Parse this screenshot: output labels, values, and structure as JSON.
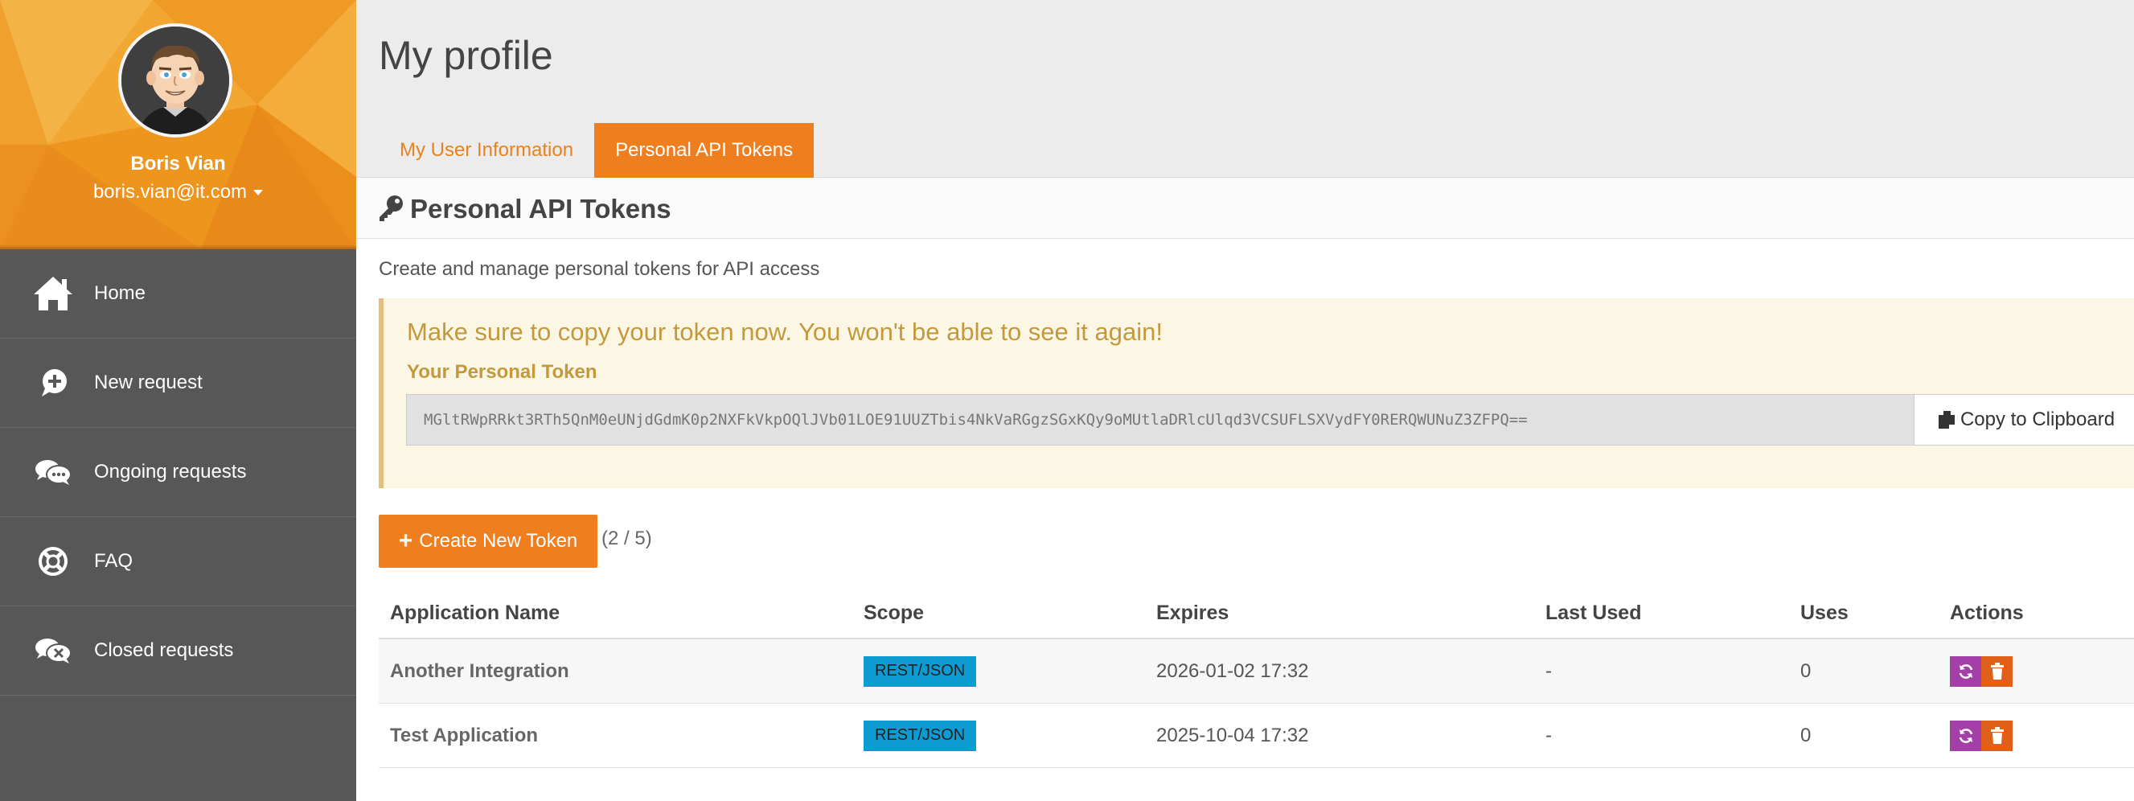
{
  "user": {
    "name": "Boris Vian",
    "email": "boris.vian@it.com"
  },
  "nav": [
    {
      "label": "Home",
      "icon": "home-icon"
    },
    {
      "label": "New request",
      "icon": "plus-bubble-icon"
    },
    {
      "label": "Ongoing requests",
      "icon": "chat-bubbles-icon"
    },
    {
      "label": "FAQ",
      "icon": "lifebuoy-icon"
    },
    {
      "label": "Closed requests",
      "icon": "closed-bubbles-icon"
    }
  ],
  "page": {
    "title": "My profile",
    "tabs": [
      {
        "label": "My User Information",
        "active": false
      },
      {
        "label": "Personal API Tokens",
        "active": true
      }
    ]
  },
  "section": {
    "title": "Personal API Tokens",
    "description": "Create and manage personal tokens for API access"
  },
  "alert": {
    "title": "Make sure to copy your token now. You won't be able to see it again!",
    "label": "Your Personal Token",
    "token": "MGltRWpRRkt3RTh5QnM0eUNjdGdmK0p2NXFkVkpOQlJVb01LOE91UUZTbis4NkVaRGgzSGxKQy9oMUtlaDRlcUlqd3VCSUFLSXVydFY0RERQWUNuZ3ZFPQ==",
    "copy_label": "Copy to Clipboard"
  },
  "create": {
    "label": "Create New Token",
    "count": "(2 / 5)"
  },
  "table": {
    "headers": [
      "Application Name",
      "Scope",
      "Expires",
      "Last Used",
      "Uses",
      "Actions"
    ],
    "rows": [
      {
        "name": "Another Integration",
        "scope": "REST/JSON",
        "expires": "2026-01-02 17:32",
        "last_used": "-",
        "uses": "0"
      },
      {
        "name": "Test Application",
        "scope": "REST/JSON",
        "expires": "2025-10-04 17:32",
        "last_used": "-",
        "uses": "0"
      }
    ]
  },
  "colors": {
    "accent": "#ef7e1f",
    "sidebar": "#575757",
    "scope_badge": "#0e9bd1",
    "regenerate": "#a33fa6",
    "delete": "#e06019",
    "alert_bg": "#fcf7e4"
  }
}
